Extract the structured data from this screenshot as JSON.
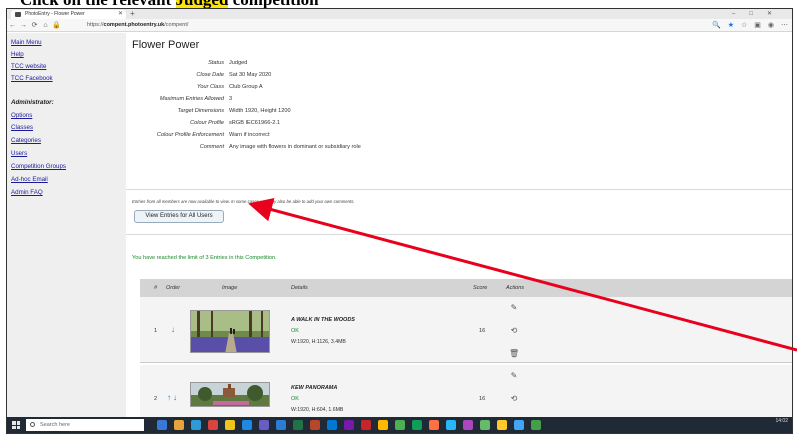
{
  "doc_heading": {
    "prefix": "Click on the relevant ",
    "highlight": "Judged",
    "suffix": " competition"
  },
  "browser": {
    "tab_title": "PhotoEntry - Flower Power",
    "new_tab": "+",
    "url_prefix": "https://",
    "url_host": "compent.photoentry.uk",
    "url_path": "/compent/"
  },
  "sidebar": {
    "links_top": [
      "Main Menu",
      "Help",
      "TCC website",
      "TCC Facebook"
    ],
    "admin_heading": "Administrator:",
    "admin_links": [
      "Options",
      "Classes",
      "Categories",
      "Users",
      "Competition Groups",
      "Ad-hoc Email",
      "Admin FAQ"
    ]
  },
  "competition": {
    "title": "Flower Power",
    "fields": [
      {
        "label": "Status",
        "value": "Judged"
      },
      {
        "label": "Close Date",
        "value": "Sat 30 May 2020"
      },
      {
        "label": "Your Class",
        "value": "Club Group A"
      },
      {
        "label": "Maximum Entries Allowed",
        "value": "3"
      },
      {
        "label": "Target Dimensions",
        "value": "Width 1920, Height 1200"
      },
      {
        "label": "Colour Profile",
        "value": "sRGB IEC61966-2.1"
      },
      {
        "label": "Colour Profile Enforcement",
        "value": "Warn if incorrect"
      },
      {
        "label": "Comment",
        "value": "Any image with flowers in dominant or subsidiary role"
      }
    ],
    "entries_note": "Entries from all members are now available to view. In some cases you may also be able to add your own comments.",
    "view_button": "View Entries for All Users",
    "limit_message": "You have reached the limit of 3 Entries in this Competition."
  },
  "table": {
    "headers": {
      "num": "#",
      "order": "Order",
      "image": "Image",
      "details": "Details",
      "score": "Score",
      "actions": "Actions"
    },
    "rows": [
      {
        "num": "1",
        "arrows": "↓",
        "name": "A WALK IN THE WOODS",
        "status": "OK",
        "dims": "W:1920, H:1126, 3.4MB",
        "score": "16"
      },
      {
        "num": "2",
        "arrows": "↑↓",
        "name": "KEW PANORAMA",
        "status": "OK",
        "dims": "W:1920, H:604, 1.6MB",
        "score": "16"
      }
    ]
  },
  "taskbar": {
    "search_placeholder": "Search here",
    "time": "14:02"
  },
  "colors": {
    "link": "#1a1a9c",
    "ok_green": "#1a8a2a",
    "annotation_arrow": "#e8001c",
    "highlight": "#ffe600"
  }
}
